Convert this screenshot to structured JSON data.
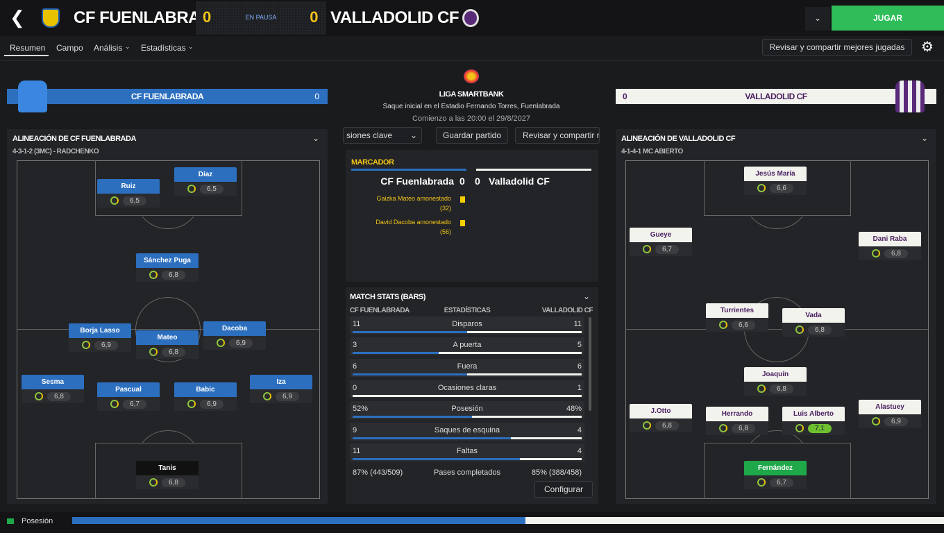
{
  "header": {
    "home_team": "CF FUENLABRADA",
    "home_score": "0",
    "status": "EN PAUSA",
    "away_score": "0",
    "away_team": "VALLADOLID CF",
    "play_button": "JUGAR"
  },
  "nav": {
    "tabs": [
      "Resumen",
      "Campo",
      "Análisis",
      "Estadísticas"
    ],
    "review_button": "Revisar y compartir mejores jugadas"
  },
  "home_banner": {
    "name": "CF FUENLABRADA",
    "score": "0"
  },
  "away_banner": {
    "name": "VALLADOLID CF",
    "score": "0"
  },
  "match_info": {
    "league": "LIGA SMARTBANK",
    "venue": "Saque inicial en el Estadio Fernando Torres, Fuenlabrada",
    "kickoff": "Comienzo a las 20:00 el 29/8/2027"
  },
  "center_buttons": {
    "key_chances": "siones clave",
    "save_match": "Guardar partido",
    "review_share": "Revisar y compartir r"
  },
  "scoreboard": {
    "title": "MARCADOR",
    "home": "CF Fuenlabrada",
    "home_score": "0",
    "away_score": "0",
    "away": "Valladolid CF",
    "events": [
      {
        "text": "Gaizka Mateo amonestado",
        "minute": "(32)"
      },
      {
        "text": "David Dacoba amonestado",
        "minute": "(56)"
      }
    ]
  },
  "stats": {
    "title": "MATCH STATS (BARS)",
    "col_home": "CF FUENLABRADA",
    "col_mid": "ESTADÍSTICAS",
    "col_away": "VALLADOLID CF",
    "rows": [
      {
        "home": "11",
        "label": "Disparos",
        "away": "11",
        "home_frac": 0.5
      },
      {
        "home": "3",
        "label": "A puerta",
        "away": "5",
        "home_frac": 0.375
      },
      {
        "home": "6",
        "label": "Fuera",
        "away": "6",
        "home_frac": 0.5
      },
      {
        "home": "0",
        "label": "Ocasiones claras",
        "away": "1",
        "home_frac": 0.0
      },
      {
        "home": "52%",
        "label": "Posesión",
        "away": "48%",
        "home_frac": 0.52
      },
      {
        "home": "9",
        "label": "Saques de esquina",
        "away": "4",
        "home_frac": 0.69
      },
      {
        "home": "11",
        "label": "Faltas",
        "away": "4",
        "home_frac": 0.73
      },
      {
        "home": "87% (443/509)",
        "label": "Pases completados",
        "away": "85% (388/458)"
      }
    ],
    "configure": "Configurar"
  },
  "home_lineup": {
    "title": "ALINEACIÓN DE CF FUENLABRADA",
    "formation": "4-3-1-2 (3MC) - RADCHENKO",
    "players": [
      {
        "name": "Ruiz",
        "rating": "6,5"
      },
      {
        "name": "Díaz",
        "rating": "6,5"
      },
      {
        "name": "Sánchez Puga",
        "rating": "6,8"
      },
      {
        "name": "Borja Lasso",
        "rating": "6,9"
      },
      {
        "name": "Mateo",
        "rating": "6,8"
      },
      {
        "name": "Dacoba",
        "rating": "6,9"
      },
      {
        "name": "Sesma",
        "rating": "6,8"
      },
      {
        "name": "Pascual",
        "rating": "6,7"
      },
      {
        "name": "Babic",
        "rating": "6,9"
      },
      {
        "name": "Iza",
        "rating": "6,9"
      },
      {
        "name": "Tanis",
        "rating": "6,8"
      }
    ]
  },
  "away_lineup": {
    "title": "ALINEACIÓN DE VALLADOLID CF",
    "formation": "4-1-4-1 MC ABIERTO",
    "players": [
      {
        "name": "Jesús María",
        "rating": "6,6"
      },
      {
        "name": "Gueye",
        "rating": "6,7"
      },
      {
        "name": "Dani Raba",
        "rating": "6,8"
      },
      {
        "name": "Turrientes",
        "rating": "6,6"
      },
      {
        "name": "Vada",
        "rating": "6,8"
      },
      {
        "name": "Joaquín",
        "rating": "6,8"
      },
      {
        "name": "J.Otto",
        "rating": "6,8"
      },
      {
        "name": "Herrando",
        "rating": "6,8"
      },
      {
        "name": "Luis Alberto",
        "rating": "7,1"
      },
      {
        "name": "Alastuey",
        "rating": "6,9"
      },
      {
        "name": "Fernández",
        "rating": "6,7"
      }
    ]
  },
  "footer": {
    "label": "Posesión",
    "home_frac": 0.52
  },
  "colors": {
    "home": "#2c6fbf",
    "away": "#f3f3ee",
    "accent": "#2ebd59",
    "play": "#2ebd59"
  }
}
